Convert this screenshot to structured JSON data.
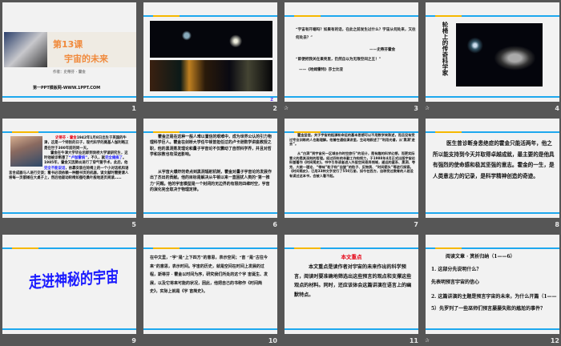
{
  "slides": [
    {
      "num": "1",
      "title_line1": "第13课",
      "title_line2": "宇宙的未来",
      "author": "作者：史蒂芬 · 霍金",
      "footer": "第一PPT模板网-WWW.1PPT.COM"
    },
    {
      "num": "2",
      "corner": "Z"
    },
    {
      "num": "3",
      "quote1": "“宇宙有开端吗？如果有的话，在此之前发生过什么？宇宙从何处来，又往何处去？”",
      "attr1": "——史蒂芬霍金",
      "quote2": "“即便把我关在果壳里，仍然自以为无限空间之王！”",
      "attr2": "——《哈姆雷特》莎士比亚"
    },
    {
      "num": "4",
      "vertical_title": "轮椅上的传奇科学家"
    },
    {
      "num": "5",
      "name": "史蒂芬 · 霍金",
      "p1": "1942年1月8日出生于英国的牛津，这是一个特别的日子，现代科学的奠基人伽利略正是在世于300年前的同一天。",
      "p2": "霍金在牛津大学毕业后即到剑桥大学读研究生，这时他被诊断患了",
      "disease": "“卢伽雷病”",
      "p3": "，不久，就",
      "paralysis": "完全瘫痪了",
      "p4": "。1985年，霍金又因肺炎进行了穿气管手术，此后，他",
      "mute": "完全不能说话",
      "p5": "，依靠安装在轮椅上的一个小对话机和语言合成器与人进行交谈；看书必须依赖一种翻书页的机器，读文献时需要请人将每一页都摊在大桌子上，然后他驱动轮椅如蚕吃桑叶般地逐页阅读……"
    },
    {
      "num": "6",
      "p1": "霍金正是在这种一般人难以置信的艰难中，成为世界公认的引力物理科学巨人。霍金在剑桥大学任牛顿曾担任过的卢卡逊数学讲座教授之职，他的黑洞蒸发理论和量子宇宙论不仅震动了自然科学界，并且对哲学和宗教也有深远影响。",
      "p2": "从宇宙大爆炸的奇点到黑洞辐射机制，霍金对量子宇宙论的发展作出了杰出的贡献。他的目标是解决从牛顿以来一直困扰人类的“第一推力”问题。他的宇宙模型是一个封闭的无边界的有限的四维时空，宇宙的演化完全取决于物理定律。"
    },
    {
      "num": "7",
      "p1": "霍金坚信，关于宇宙的起源和命运的基本思想可以不用数学来陈述，而且没有受过专业训练的人也能理解。他曾在通俗演讲里，生动地叙述了“利用光谱，从‘黑洞’进去”。",
      "p2": "从“白洞”到宇宙另一区域去作时空旅行”的设计，是有趣的科学幻想，而更实际意义的是其深刻的哲理。经过四年的辛勤工作和努力，于1988年4月正式出版宇宙论科普著作《时间简史》。书中引导读者进入外层空间奇异领域，遥远的星系、黑洞、夸克、大统一理论、“带味”粒子和“自旋”的粒子、反物质、“时间箭头”等进行探索。《时间简史》，已用33种文字发行了550万册，如今在西方，自称受过教育的人若没有读过这本书，会被人看不起。"
    },
    {
      "num": "8",
      "p1": "医生曾诊断身患绝症的霍金只能活两年，他之所以能支持到今天并取得卓越成就，最主要的是他具有强烈的使命感和极其坚强的意志。霍金的一生，是人类意志力的记录，是科学精神创造的奇迹。"
    },
    {
      "num": "9",
      "title": "走进神秘的宇宙"
    },
    {
      "num": "10",
      "p1": "在中文里，“宇”是“上下四方”的意思，表示空间；“宙 ”是“古往今来”的意思，表示时间。宇宙的历史，就是空间在时间上发展的过程，斯蒂芬 · 霍金以时间为序，研究我们所处的这个宇 宙诞生、发展，以及它将来可能的状况，因此，他把自己的书称作《时间简史》，实际上就是《宇 宙简史》。"
    },
    {
      "num": "11",
      "heading": "本文重点",
      "p1": "本文重点是读作者对宇宙的未来作出的科学预言，阅读时要准确地筛选出这些预言的观点和支撑这些观点的材料。同时，还应该体会这篇讲演在语言上的幽默特点。"
    },
    {
      "num": "12",
      "heading": "阅读文章 · 赏析归纳（1——6）",
      "q1": "1. 这部分先说明什么？",
      "a1": "先表明预言宇宙的信心",
      "q2": "2. 这篇讲演的主题是预言宇宙的未来，为什么开篇（1——5）先罗列了一些巫师们预言屡屡失败的尴尬的事件？"
    }
  ],
  "colors": {
    "stripe_blue": "#1ea8ee",
    "stripe_orange": "#f5b800",
    "title_orange": "#f08a3c",
    "highlight_blue": "#1a1aff",
    "red": "#e60012"
  }
}
